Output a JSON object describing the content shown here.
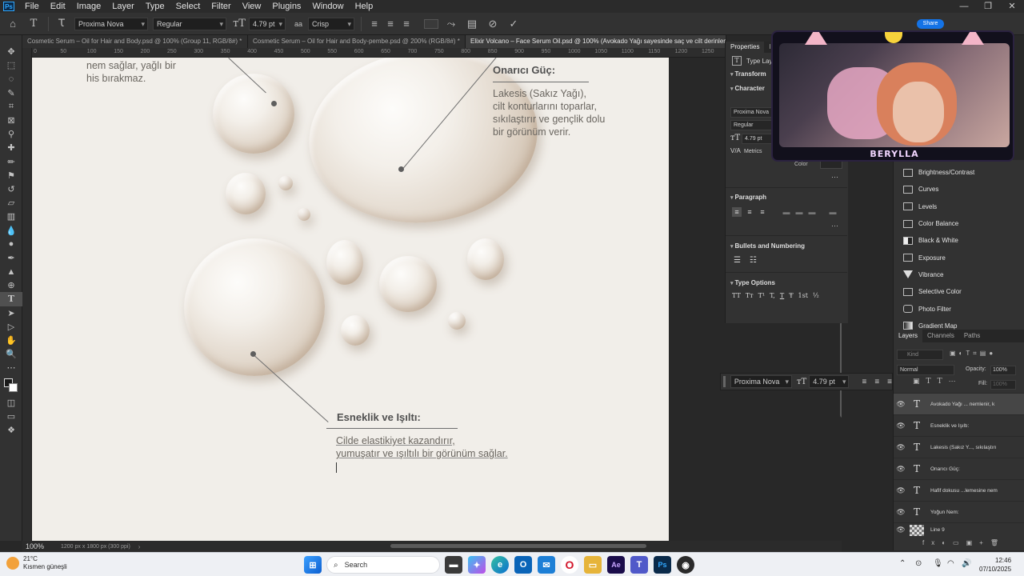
{
  "menubar": {
    "items": [
      "File",
      "Edit",
      "Image",
      "Layer",
      "Type",
      "Select",
      "Filter",
      "View",
      "Plugins",
      "Window",
      "Help"
    ],
    "ps_badge": "Ps",
    "share_label": "Share"
  },
  "options": {
    "font_family": "Proxima Nova",
    "font_style": "Regular",
    "font_size": "4.79 pt",
    "antialias": "Crisp",
    "aa_badge": "aa"
  },
  "tabs": [
    "Cosmetic Serum – Oil for Hair and Body.psd @ 100% (Group 11, RGB/8#) *",
    "Cosmetic Serum – Oil for Hair and Body-pembe.psd @ 200% (RGB/8#) *",
    "Elixir Volcano – Face Serum Oil.psd @ 100% (Avokado Yağı sayesinde saç ve cilt derinlemesi"
  ],
  "ruler_top": [
    "0",
    "50",
    "100",
    "150",
    "200",
    "250",
    "300",
    "350",
    "400",
    "450",
    "500",
    "550",
    "600",
    "650",
    "700",
    "750",
    "800",
    "850",
    "900",
    "950",
    "1000",
    "1050",
    "1100",
    "1150",
    "1200",
    "1250"
  ],
  "artboard": {
    "top_left_text": "nem sağlar, yağlı bir\nhis bırakmaz.",
    "heading_1": "Onarıcı Güç:",
    "body_1": "Lakesis (Sakız Yağı),\ncilt konturlarını toparlar,\nsıkılaştırır ve gençlik dolu\nbir görünüm verir.",
    "heading_2": "Esneklik ve Işıltı:",
    "body_2": "Cilde elastikiyet kazandırır,\nyumuşatır ve ışıltılı bir görünüm sağlar."
  },
  "status": {
    "zoom": "100%",
    "doc_info": "1200 px x 1800 px (300 ppi)"
  },
  "properties": {
    "tabs": [
      "Properties",
      "Ir"
    ],
    "type_layer": "Type Layer",
    "sections": {
      "transform": "Transform",
      "character": "Character",
      "paragraph": "Paragraph",
      "bullets": "Bullets and Numbering",
      "type_options": "Type Options"
    },
    "font_family": "Proxima Nova",
    "font_style": "Regular",
    "font_size": "4.79 pt",
    "kerning": "Metrics",
    "color_label": "Color",
    "type_glyphs": [
      "TT",
      "Tт",
      "T¹",
      "T,",
      "T",
      "Ŧ",
      "1st",
      "½"
    ]
  },
  "adjustments": {
    "items": [
      {
        "label": "Brightness/Contrast",
        "icon": "brightness-icon"
      },
      {
        "label": "Curves",
        "icon": "curves-icon"
      },
      {
        "label": "Levels",
        "icon": "levels-icon"
      },
      {
        "label": "Color Balance",
        "icon": "color-balance-icon"
      },
      {
        "label": "Black & White",
        "icon": "black-white-icon"
      },
      {
        "label": "Exposure",
        "icon": "exposure-icon"
      },
      {
        "label": "Vibrance",
        "icon": "vibrance-icon"
      },
      {
        "label": "Selective Color",
        "icon": "selective-color-icon"
      },
      {
        "label": "Photo Filter",
        "icon": "photo-filter-icon"
      },
      {
        "label": "Gradient Map",
        "icon": "gradient-map-icon"
      }
    ]
  },
  "floating_type_bar": {
    "font_family": "Proxima Nova",
    "font_size": "4.79 pt"
  },
  "layers": {
    "tabs": [
      "Layers",
      "Channels",
      "Paths"
    ],
    "search_placeholder": "Kind",
    "blend_mode": "Normal",
    "opacity_label": "Opacity:",
    "opacity_value": "100%",
    "fill_label": "Fill:",
    "fill_value": "100%",
    "rows": [
      {
        "name": "Avokado Yağı ... nemlenir, k",
        "type": "T",
        "selected": true
      },
      {
        "name": "Esneklik ve Işıltı:",
        "type": "T",
        "selected": false
      },
      {
        "name": "Lakesis (Sakız Y..., sıkılaştırı",
        "type": "T",
        "selected": false
      },
      {
        "name": "Onarıcı Güç:",
        "type": "T",
        "selected": false
      },
      {
        "name": "Hafif dokusu ...lemesine nem",
        "type": "T",
        "selected": false
      },
      {
        "name": "Yoğun Nem:",
        "type": "T",
        "selected": false
      },
      {
        "name": "Line 9",
        "type": "shape",
        "selected": false
      }
    ]
  },
  "webcam": {
    "name": "BERYLLA"
  },
  "taskbar": {
    "temperature": "21°C",
    "weather": "Kısmen güneşli",
    "search_label": "Search",
    "time": "12:46",
    "date": "07/10/2025",
    "apps": [
      {
        "icon": "windows-start-icon",
        "color": "#1f6fd6"
      },
      {
        "icon": "file-explorer-dark-icon",
        "color": "#3a3a3a"
      },
      {
        "icon": "copilot-icon",
        "color": "#7b57e0"
      },
      {
        "icon": "edge-icon",
        "color": "#0c7fd0"
      },
      {
        "icon": "outlook-icon",
        "color": "#0a64b8"
      },
      {
        "icon": "mail-icon",
        "color": "#1d7fd6"
      },
      {
        "icon": "opera-icon",
        "color": "#d2152b"
      },
      {
        "icon": "folder-icon",
        "color": "#e6b43a"
      },
      {
        "icon": "after-effects-icon",
        "color": "#1a0c4a"
      },
      {
        "icon": "teams-icon",
        "color": "#5059c9"
      },
      {
        "icon": "photoshop-icon",
        "color": "#0a2a4a"
      },
      {
        "icon": "obs-icon",
        "color": "#2a2a2a"
      }
    ]
  }
}
